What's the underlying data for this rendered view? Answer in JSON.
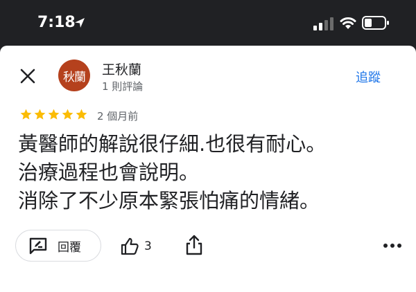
{
  "status_bar": {
    "time": "7:18",
    "icons": [
      "location-arrow-icon",
      "cellular-signal-icon",
      "wifi-icon",
      "battery-icon"
    ]
  },
  "reviewer": {
    "avatar_text": "秋蘭",
    "avatar_color": "#b5411d",
    "name": "王秋蘭",
    "review_count": "1 則評論"
  },
  "header": {
    "close_icon": "close-icon",
    "follow_label": "追蹤"
  },
  "review": {
    "rating": 5,
    "max_rating": 5,
    "date": "2 個月前",
    "lines": [
      "黃醫師的解說很仔細.也很有耐心。",
      "治療過程也會說明。",
      "消除了不少原本緊張怕痛的情緒。"
    ]
  },
  "actions": {
    "reply_label": "回覆",
    "like_count": "3",
    "icons": [
      "reply-icon",
      "thumbs-up-icon",
      "share-icon",
      "more-icon"
    ]
  },
  "colors": {
    "star": "#fbbc04",
    "link": "#1a73e8",
    "status_bar_bg": "#202124"
  }
}
